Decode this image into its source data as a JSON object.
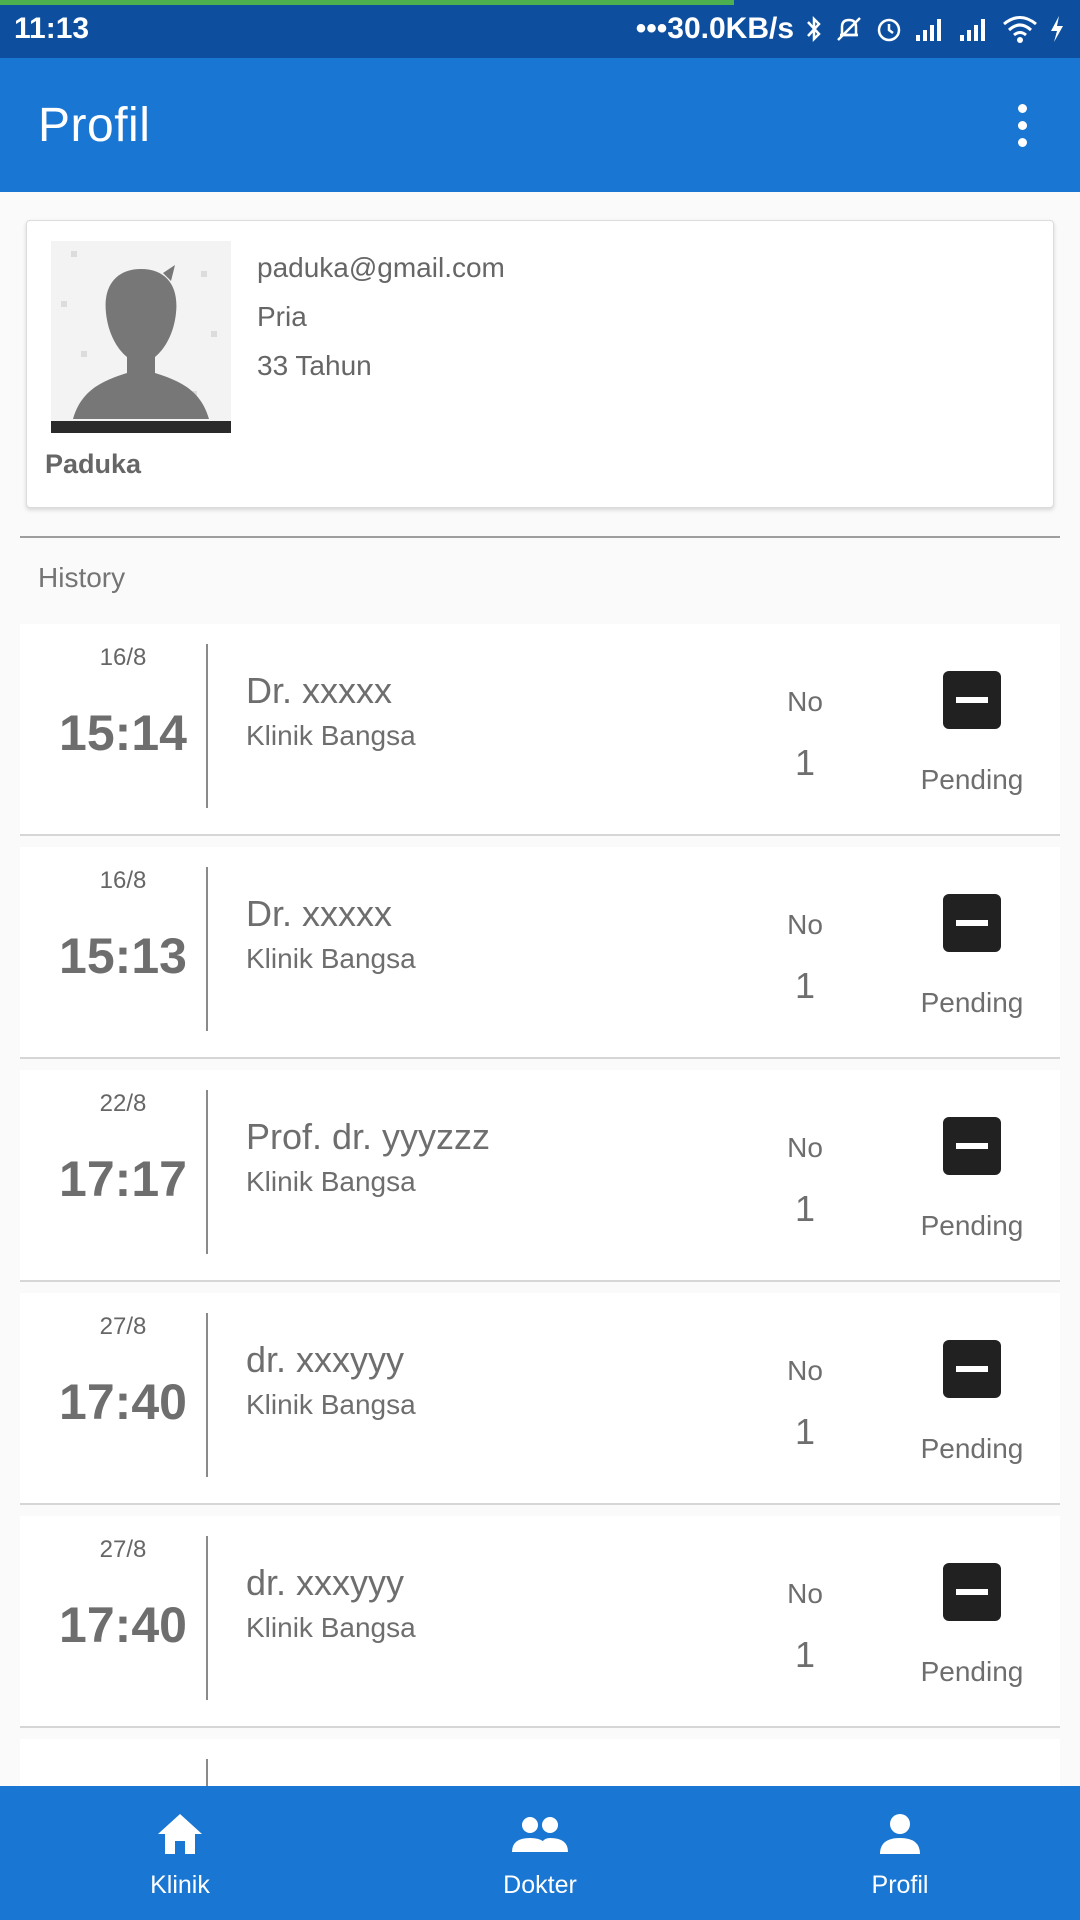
{
  "status_bar": {
    "time": "11:13",
    "network_speed": "•••30.0KB/s",
    "icons": [
      "bluetooth-icon",
      "mute-icon",
      "alarm-icon",
      "signal-icon",
      "signal-icon",
      "wifi-icon",
      "charging-icon"
    ],
    "progress": 0.68
  },
  "app_bar": {
    "title": "Profil",
    "menu_icon": "more-vert-icon"
  },
  "profile": {
    "email": "paduka@gmail.com",
    "gender": "Pria",
    "age": "33 Tahun",
    "name": "Paduka",
    "avatar_icon": "person-silhouette-icon"
  },
  "history": {
    "label": "History",
    "items": [
      {
        "date": "16/8",
        "time": "15:14",
        "doctor": "Dr. xxxxx",
        "clinic": "Klinik Bangsa",
        "no_label": "No",
        "no_value": "1",
        "status": "Pending"
      },
      {
        "date": "16/8",
        "time": "15:13",
        "doctor": "Dr. xxxxx",
        "clinic": "Klinik Bangsa",
        "no_label": "No",
        "no_value": "1",
        "status": "Pending"
      },
      {
        "date": "22/8",
        "time": "17:17",
        "doctor": "Prof. dr. yyyzzz",
        "clinic": "Klinik Bangsa",
        "no_label": "No",
        "no_value": "1",
        "status": "Pending"
      },
      {
        "date": "27/8",
        "time": "17:40",
        "doctor": "dr. xxxyyy",
        "clinic": "Klinik Bangsa",
        "no_label": "No",
        "no_value": "1",
        "status": "Pending"
      },
      {
        "date": "27/8",
        "time": "17:40",
        "doctor": "dr. xxxyyy",
        "clinic": "Klinik Bangsa",
        "no_label": "No",
        "no_value": "1",
        "status": "Pending"
      }
    ]
  },
  "bottom_nav": {
    "items": [
      {
        "label": "Klinik",
        "icon": "home-icon"
      },
      {
        "label": "Dokter",
        "icon": "people-icon"
      },
      {
        "label": "Profil",
        "icon": "person-icon"
      }
    ]
  },
  "colors": {
    "primary": "#1976d2",
    "status_bar": "#0d4f9e",
    "status_icon": "#212121"
  }
}
